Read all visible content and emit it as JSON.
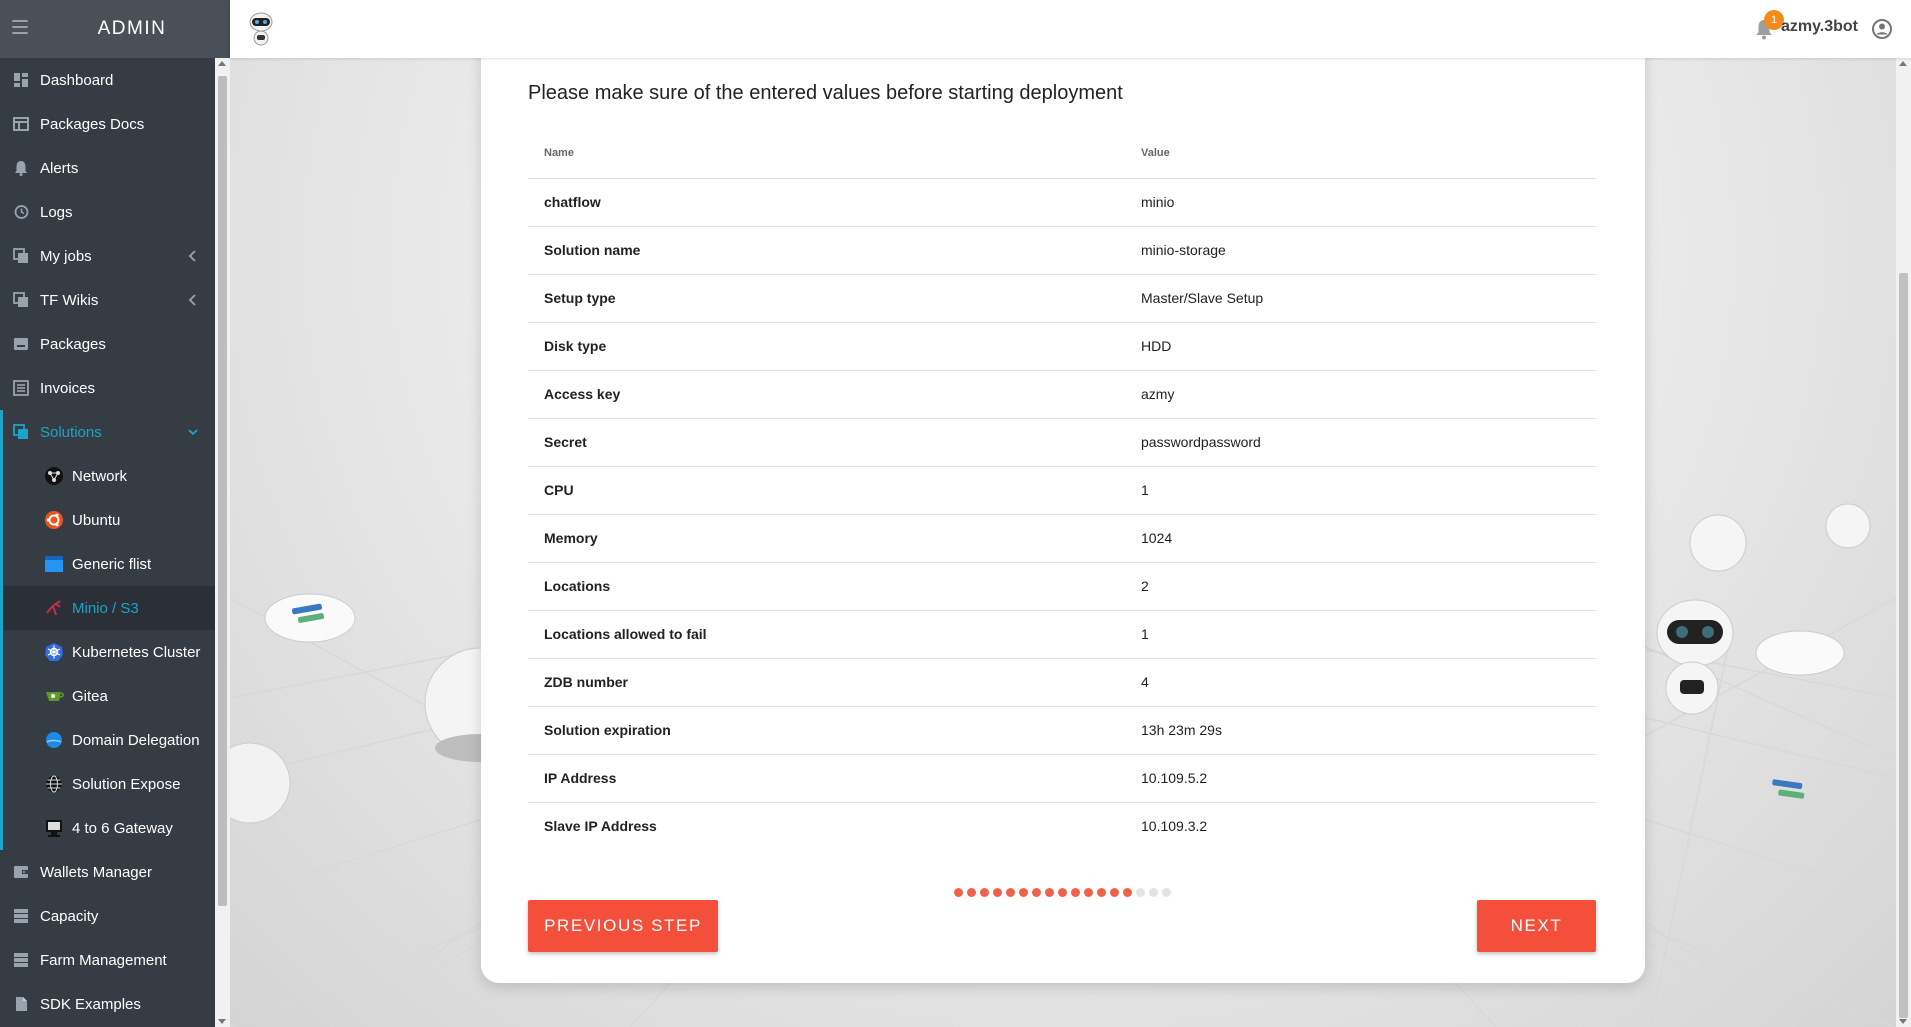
{
  "app": {
    "brand": "ADMIN",
    "username": "azmy.3bot",
    "notification_count": "1"
  },
  "sidebar": {
    "items": [
      {
        "label": "Dashboard",
        "icon": "dashboard-icon"
      },
      {
        "label": "Packages Docs",
        "icon": "docs-icon"
      },
      {
        "label": "Alerts",
        "icon": "bell-icon"
      },
      {
        "label": "Logs",
        "icon": "history-icon"
      },
      {
        "label": "My jobs",
        "icon": "copy-icon",
        "expandable": true
      },
      {
        "label": "TF Wikis",
        "icon": "copy-icon",
        "expandable": true
      },
      {
        "label": "Packages",
        "icon": "package-icon"
      },
      {
        "label": "Invoices",
        "icon": "list-icon"
      },
      {
        "label": "Solutions",
        "icon": "copy-icon",
        "expanded": true,
        "active": true
      }
    ],
    "solutions": [
      {
        "label": "Network",
        "icon": "network-icon"
      },
      {
        "label": "Ubuntu",
        "icon": "ubuntu-icon"
      },
      {
        "label": "Generic flist",
        "icon": "flist-icon"
      },
      {
        "label": "Minio / S3",
        "icon": "minio-icon",
        "selected": true
      },
      {
        "label": "Kubernetes Cluster",
        "icon": "kubernetes-icon"
      },
      {
        "label": "Gitea",
        "icon": "gitea-icon"
      },
      {
        "label": "Domain Delegation",
        "icon": "domain-icon"
      },
      {
        "label": "Solution Expose",
        "icon": "globe-icon"
      },
      {
        "label": "4 to 6 Gateway",
        "icon": "gateway-icon"
      }
    ],
    "bottom_items": [
      {
        "label": "Wallets Manager",
        "icon": "wallet-icon"
      },
      {
        "label": "Capacity",
        "icon": "capacity-icon"
      },
      {
        "label": "Farm Management",
        "icon": "farm-icon"
      },
      {
        "label": "SDK Examples",
        "icon": "file-icon"
      }
    ]
  },
  "card": {
    "title": "Please make sure of the entered values before starting deployment",
    "table": {
      "headers": [
        "Name",
        "Value"
      ],
      "rows": [
        [
          "chatflow",
          "minio"
        ],
        [
          "Solution name",
          "minio-storage"
        ],
        [
          "Setup type",
          "Master/Slave Setup"
        ],
        [
          "Disk type",
          "HDD"
        ],
        [
          "Access key",
          "azmy"
        ],
        [
          "Secret",
          "passwordpassword"
        ],
        [
          "CPU",
          "1"
        ],
        [
          "Memory",
          "1024"
        ],
        [
          "Locations",
          "2"
        ],
        [
          "Locations allowed to fail",
          "1"
        ],
        [
          "ZDB number",
          "4"
        ],
        [
          "Solution expiration",
          "13h 23m 29s"
        ],
        [
          "IP Address",
          "10.109.5.2"
        ],
        [
          "Slave IP Address",
          "10.109.3.2"
        ]
      ]
    },
    "progress": {
      "completed_steps": 14,
      "total_steps": 17
    },
    "buttons": {
      "previous": "PREVIOUS STEP",
      "next": "NEXT"
    }
  },
  "colors": {
    "accent": "#1ba4c8",
    "button": "#f44f3b",
    "sidebar_bg": "#363c44",
    "badge": "#f28b1c"
  }
}
